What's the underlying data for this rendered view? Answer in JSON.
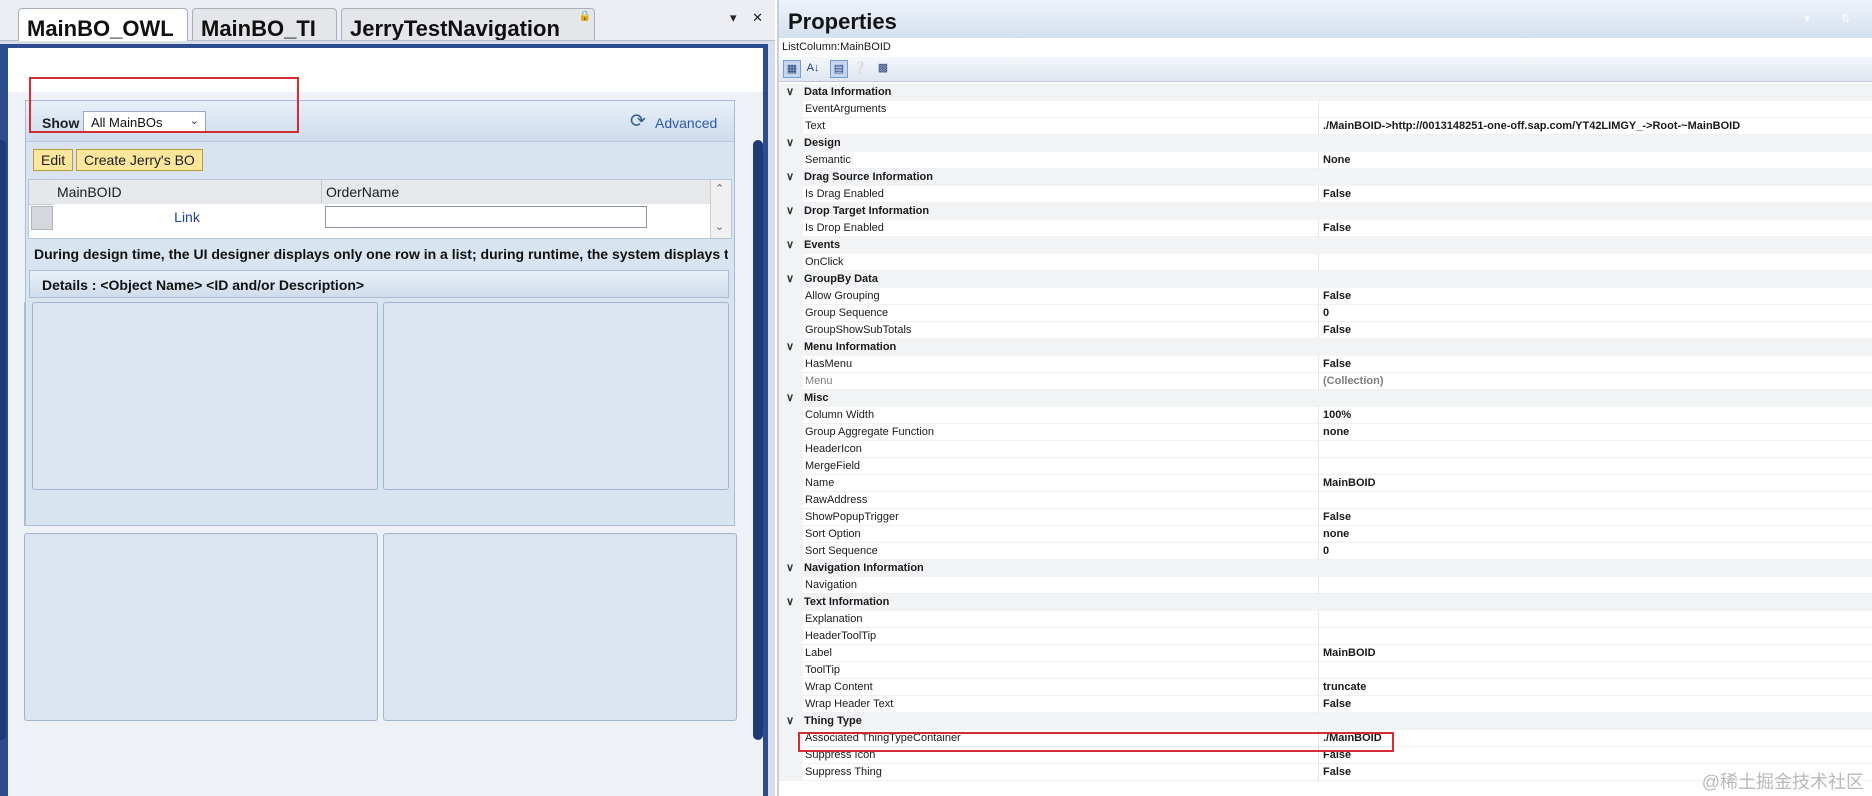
{
  "tabs": [
    {
      "label": "MainBO_OWL",
      "active": true
    },
    {
      "label": "MainBO_TI",
      "active": false
    },
    {
      "label": "JerryTestNavigation",
      "active": false
    }
  ],
  "tab_controls": "▾ ✕",
  "designer": {
    "show_label": "Show",
    "show_value": "All MainBOs",
    "advanced_label": "Advanced",
    "edit_label": "Edit",
    "create_label": "Create Jerry's BO",
    "columns": [
      "MainBOID",
      "OrderName"
    ],
    "link_text": "Link",
    "design_note": "During design time, the UI designer displays only one row in a list; during runtime, the system displays the",
    "details_header": "Details : <Object Name> <ID and/or Description>"
  },
  "properties": {
    "title": "Properties",
    "object": "ListColumn:MainBOID",
    "rows": [
      {
        "type": "cat",
        "name": "Data Information"
      },
      {
        "type": "prop",
        "name": "EventArguments",
        "value": ""
      },
      {
        "type": "prop",
        "name": "Text",
        "value": "./MainBOID->http://0013148251-one-off.sap.com/YT42LIMGY_->Root-~MainBOID"
      },
      {
        "type": "cat",
        "name": "Design"
      },
      {
        "type": "prop",
        "name": "Semantic",
        "value": "None"
      },
      {
        "type": "cat",
        "name": "Drag Source Information"
      },
      {
        "type": "prop",
        "name": "Is Drag Enabled",
        "value": "False"
      },
      {
        "type": "cat",
        "name": "Drop Target Information"
      },
      {
        "type": "prop",
        "name": "Is Drop Enabled",
        "value": "False"
      },
      {
        "type": "cat",
        "name": "Events"
      },
      {
        "type": "prop",
        "name": "OnClick",
        "value": ""
      },
      {
        "type": "cat",
        "name": "GroupBy Data"
      },
      {
        "type": "prop",
        "name": "Allow Grouping",
        "value": "False"
      },
      {
        "type": "prop",
        "name": "Group Sequence",
        "value": "0"
      },
      {
        "type": "prop",
        "name": "GroupShowSubTotals",
        "value": "False"
      },
      {
        "type": "cat",
        "name": "Menu Information"
      },
      {
        "type": "prop",
        "name": "HasMenu",
        "value": "False"
      },
      {
        "type": "prop",
        "name": "Menu",
        "value": "(Collection)",
        "readonly": true
      },
      {
        "type": "cat",
        "name": "Misc"
      },
      {
        "type": "prop",
        "name": "Column Width",
        "value": "100%"
      },
      {
        "type": "prop",
        "name": "Group Aggregate Function",
        "value": "none"
      },
      {
        "type": "prop",
        "name": "HeaderIcon",
        "value": ""
      },
      {
        "type": "prop",
        "name": "MergeField",
        "value": ""
      },
      {
        "type": "prop",
        "name": "Name",
        "value": "MainBOID"
      },
      {
        "type": "prop",
        "name": "RawAddress",
        "value": ""
      },
      {
        "type": "prop",
        "name": "ShowPopupTrigger",
        "value": "False"
      },
      {
        "type": "prop",
        "name": "Sort Option",
        "value": "none"
      },
      {
        "type": "prop",
        "name": "Sort Sequence",
        "value": "0"
      },
      {
        "type": "cat",
        "name": "Navigation Information"
      },
      {
        "type": "prop",
        "name": "Navigation",
        "value": ""
      },
      {
        "type": "cat",
        "name": "Text Information"
      },
      {
        "type": "prop",
        "name": "Explanation",
        "value": ""
      },
      {
        "type": "prop",
        "name": "HeaderToolTip",
        "value": ""
      },
      {
        "type": "prop",
        "name": "Label",
        "value": "MainBOID"
      },
      {
        "type": "prop",
        "name": "ToolTip",
        "value": ""
      },
      {
        "type": "prop",
        "name": "Wrap Content",
        "value": "truncate"
      },
      {
        "type": "prop",
        "name": "Wrap Header Text",
        "value": "False"
      },
      {
        "type": "cat",
        "name": "Thing Type"
      },
      {
        "type": "prop",
        "name": "Associated ThingTypeContainer",
        "value": "./MainBOID"
      },
      {
        "type": "prop",
        "name": "Suppress Icon",
        "value": "False"
      },
      {
        "type": "prop",
        "name": "Suppress Thing",
        "value": "False"
      }
    ]
  },
  "watermark": "@稀土掘金技术社区",
  "colors": {
    "highlight": "#d52c33",
    "link": "#2a5aa8",
    "button": "#fbe69c"
  }
}
